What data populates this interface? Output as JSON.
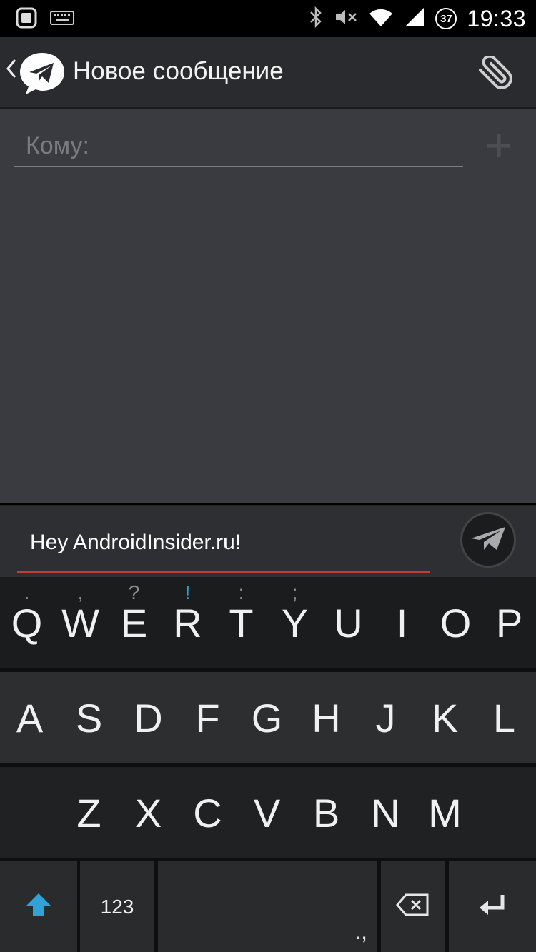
{
  "status_bar": {
    "time": "19:33",
    "badge": "37",
    "icons": [
      "app-square-icon",
      "keyboard-icon",
      "bluetooth-icon",
      "volume-mute-icon",
      "wifi-icon",
      "signal-icon"
    ]
  },
  "action_bar": {
    "title": "Новое сообщение",
    "icons": [
      "back-chevron-icon",
      "paper-plane-logo-icon",
      "paperclip-icon"
    ]
  },
  "recipient": {
    "placeholder": "Кому:",
    "add_icon": "plus-icon"
  },
  "compose": {
    "message_text": "Hey AndroidInsider.ru!",
    "send_icon": "paper-plane-send-icon"
  },
  "keyboard": {
    "row1": [
      {
        "key": "Q",
        "hint": "."
      },
      {
        "key": "W",
        "hint": ","
      },
      {
        "key": "E",
        "hint": "?"
      },
      {
        "key": "R",
        "hint": "!"
      },
      {
        "key": "T",
        "hint": ":"
      },
      {
        "key": "Y",
        "hint": ";"
      },
      {
        "key": "U",
        "hint": ""
      },
      {
        "key": "I",
        "hint": ""
      },
      {
        "key": "O",
        "hint": ""
      },
      {
        "key": "P",
        "hint": ""
      }
    ],
    "row2": [
      "A",
      "S",
      "D",
      "F",
      "G",
      "H",
      "J",
      "K",
      "L"
    ],
    "row3": [
      "Z",
      "X",
      "C",
      "V",
      "B",
      "N",
      "M"
    ],
    "symbols_label": "123",
    "space_hint": ".,",
    "colors": {
      "shift_accent": "#2fa3d8",
      "hint_accent": "#2fa3d8",
      "input_underline": "#c43c3c"
    }
  }
}
